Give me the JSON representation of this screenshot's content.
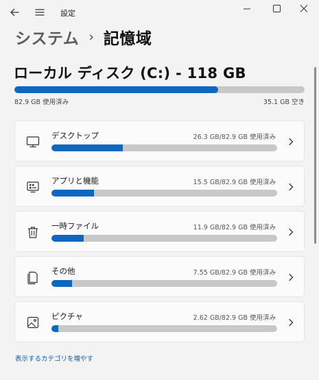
{
  "window": {
    "title": "設定",
    "back_icon": "back-arrow-icon",
    "menu_icon": "hamburger-menu-icon",
    "controls": [
      "minimize-icon",
      "maximize-icon",
      "close-icon"
    ]
  },
  "breadcrumb": {
    "parent": "システム",
    "separator": "›",
    "current": "記憶域"
  },
  "drive": {
    "title": "ローカル ディスク (C:) - 118 GB",
    "used_label": "82.9 GB 使用済み",
    "free_label": "35.1 GB 空き",
    "used_fraction": 0.7025
  },
  "categories": [
    {
      "label": "デスクトップ",
      "usage": "26.3 GB/82.9 GB 使用済み",
      "fraction": 0.317,
      "icon": "desktop-monitor-icon"
    },
    {
      "label": "アプリと機能",
      "usage": "15.5 GB/82.9 GB 使用済み",
      "fraction": 0.187,
      "icon": "apps-features-icon"
    },
    {
      "label": "一時ファイル",
      "usage": "11.9 GB/82.9 GB 使用済み",
      "fraction": 0.1435,
      "icon": "trash-icon"
    },
    {
      "label": "その他",
      "usage": "7.55 GB/82.9 GB 使用済み",
      "fraction": 0.091,
      "icon": "document-other-icon"
    },
    {
      "label": "ピクチャ",
      "usage": "2.62 GB/82.9 GB 使用済み",
      "fraction": 0.0316,
      "icon": "picture-icon"
    }
  ],
  "more_link": "表示するカテゴリを増やす",
  "colors": {
    "accent": "#0f67c0",
    "track": "#c8c8c8",
    "background": "#f3f3f3",
    "card": "#fbfbfb",
    "link": "#0f5bb0"
  }
}
